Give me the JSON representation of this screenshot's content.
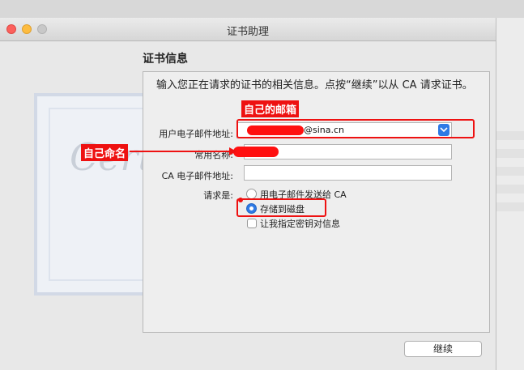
{
  "window": {
    "title": "证书助理"
  },
  "section": {
    "heading": "证书信息"
  },
  "description": "输入您正在请求的证书的相关信息。点按“继续”以从 CA 请求证书。",
  "form": {
    "email_label": "用户电子邮件地址:",
    "email_value": "@sina.cn",
    "common_name_label": "常用名称:",
    "ca_email_label": "CA 电子邮件地址:",
    "request_label": "请求是:",
    "option_email_ca": "用电子邮件发送给 CA",
    "option_save_disk": "存储到磁盘",
    "option_specify_key": "让我指定密钥对信息",
    "selected_option": "存储到磁盘"
  },
  "annotations": {
    "own_email": "自己的邮箱",
    "own_name": "自己命名"
  },
  "buttons": {
    "continue": "继续"
  },
  "colors": {
    "accent": "#2f7ae5",
    "annotation_red": "#ee1111"
  },
  "background_art": {
    "cert_word": "Certificate"
  }
}
